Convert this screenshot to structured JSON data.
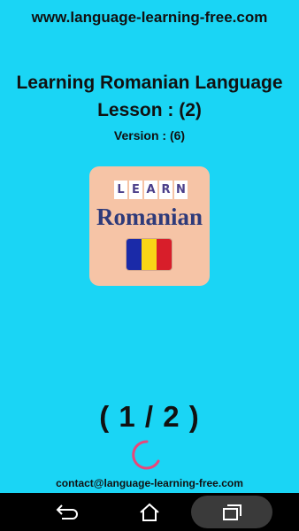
{
  "header": {
    "site_url": "www.language-learning-free.com"
  },
  "intro": {
    "title_line1": "Learning Romanian Language",
    "title_line2": "Lesson : (2)",
    "version": "Version : (6)"
  },
  "logo": {
    "learn_letters": [
      "L",
      "E",
      "A",
      "R",
      "N"
    ],
    "language_word": "Romanian",
    "flag_colors": [
      "#1a2aa8",
      "#f9d616",
      "#d81e2a"
    ]
  },
  "progress": {
    "counter": "( 1 / 2 )"
  },
  "footer": {
    "contact": "contact@language-learning-free.com"
  },
  "nav": {
    "back_icon": "back-icon",
    "home_icon": "home-icon",
    "recents_icon": "recents-icon"
  },
  "colors": {
    "background": "#1ad5f5",
    "spinner": "#e8477a"
  }
}
